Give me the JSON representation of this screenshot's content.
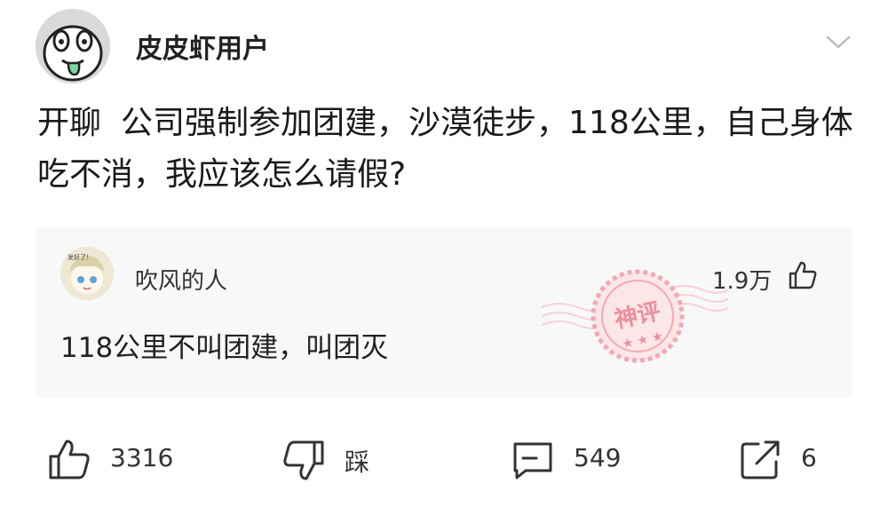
{
  "post": {
    "username": "皮皮虾用户",
    "tag": "开聊",
    "text": "公司强制参加团建，沙漠徒步，118公里，自己身体吃不消，我应该怎么请假?"
  },
  "comment": {
    "username": "吹风的人",
    "likes": "1.9万",
    "text": "118公里不叫团建，叫团灭",
    "stamp_text": "神评",
    "avatar_caption": "发好了！"
  },
  "actions": {
    "like_count": "3316",
    "dislike_label": "踩",
    "comment_count": "549",
    "share_count": "6"
  },
  "icons": {
    "more": "chevron-down-icon",
    "comment_like": "thumbs-up-icon",
    "like": "thumbs-up-icon",
    "dislike": "thumbs-down-icon",
    "comment": "comment-bubble-icon",
    "share": "share-icon"
  },
  "colors": {
    "stamp": "#f5b3bb",
    "comment_bg": "#f8f8f8",
    "icon": "#333333"
  }
}
